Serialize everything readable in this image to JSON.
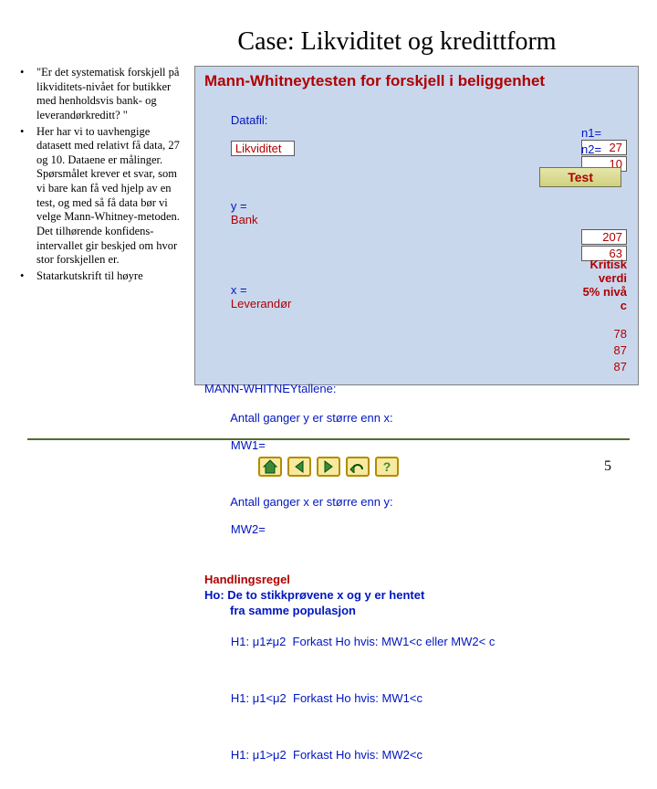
{
  "title": "Case: Likviditet og kredittform",
  "bullets": [
    "\"Er det systematisk forskjell på likviditets-nivået for butikker med henholdsvis bank- og leverandørkreditt? \"",
    "Her har vi to uavhengige datasett med relativt få data, 27 og 10. Dataene er målinger. Spørsmålet krever et svar, som vi bare kan få ved hjelp av en test, og med så få data bør vi velge Mann-Whitney-metoden. Det tilhørende konfidens-intervallet gir beskjed om hvor stor forskjellen er.",
    "Statarkutskrift til høyre"
  ],
  "panel": {
    "heading": "Mann-Whitneytesten for forskjell i beliggenhet",
    "datafil_label": "Datafil:",
    "datafil_value": "Likviditet",
    "y_label": "y =",
    "y_value": "Bank",
    "x_label": "x =",
    "x_value": "Leverandør",
    "n1_label": "n1=",
    "n1_value": "27",
    "n2_label": "n2=",
    "n2_value": "10",
    "test_button": "Test",
    "section_title": "MANN-WHITNEYtallene:",
    "mw_desc1": "Antall ganger y er større enn x:",
    "mw_desc2": "Antall ganger x er større enn y:",
    "mw1_label": "MW1=",
    "mw1_value": "207",
    "mw2_label": "MW2=",
    "mw2_value": "63",
    "handling_title": "Handlingsregel",
    "ho_line": "Ho: De to stikkprøvene x og y er hentet",
    "ho_line2": "fra samme populasjon",
    "kritisk_l1": "Kritisk",
    "kritisk_l2": "verdi",
    "kritisk_l3": "5% nivå",
    "kritisk_l4": "c",
    "h1a": "H1: μ1≠μ2  Forkast Ho hvis: MW1<c eller MW2< c",
    "h1a_val": "78",
    "h1b": "H1: μ1<μ2  Forkast Ho hvis: MW1<c",
    "h1b_val": "87",
    "h1c": "H1: μ1>μ2  Forkast Ho hvis: MW2<c",
    "h1c_val": "87"
  },
  "page_number": "5",
  "icons": {
    "home": "home-icon",
    "prev": "prev-icon",
    "next": "next-icon",
    "undo": "undo-icon",
    "help": "help-icon"
  }
}
